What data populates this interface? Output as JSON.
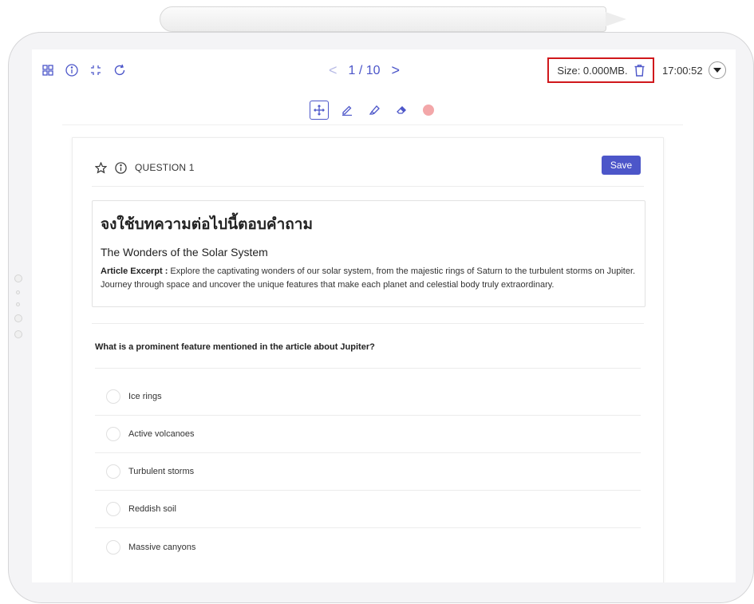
{
  "pager": {
    "prev": "<",
    "text": "1 / 10",
    "next": ">"
  },
  "size": {
    "label": "Size: 0.000MB."
  },
  "clock": {
    "time": "17:00:52"
  },
  "icons": {
    "grid": "grid-icon",
    "info": "info-icon",
    "expand": "expand-icon",
    "refresh": "refresh-icon",
    "trash": "trash-icon",
    "dropdown": "chevron-down-icon",
    "move": "move-icon",
    "pen": "pen-icon",
    "highlighter": "highlighter-icon",
    "eraser": "eraser-icon",
    "star": "star-icon"
  },
  "colors": {
    "accent": "#4c56c9",
    "highlight_box": "#d0181c",
    "pen_color": "#f3a7a9"
  },
  "question": {
    "label": "QUESTION 1",
    "save_label": "Save",
    "passage_heading": "จงใช้บทความต่อไปนี้ตอบคำถาม",
    "passage_title": "The Wonders of the Solar System",
    "excerpt_label": "Article Excerpt :",
    "excerpt_text": " Explore the captivating wonders of our solar system, from the majestic rings of Saturn to the turbulent storms on Jupiter. Journey through space and uncover the unique features that make each planet and celestial body truly extraordinary.",
    "prompt": "What is a prominent feature mentioned in the article about Jupiter?",
    "options": [
      {
        "label": "Ice rings"
      },
      {
        "label": "Active volcanoes"
      },
      {
        "label": "Turbulent storms"
      },
      {
        "label": "Reddish soil"
      },
      {
        "label": "Massive canyons"
      }
    ]
  }
}
